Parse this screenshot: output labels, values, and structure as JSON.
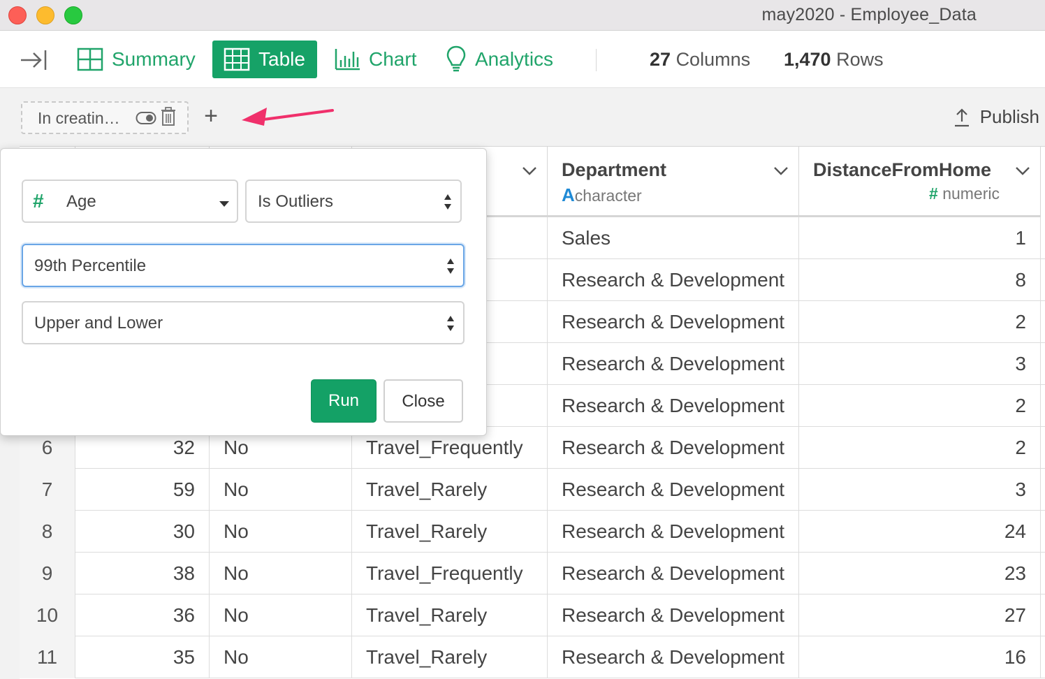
{
  "window": {
    "title": "may2020 - Employee_Data"
  },
  "toolbar": {
    "tabs": [
      {
        "label": "Summary",
        "icon": "summary-grid-icon"
      },
      {
        "label": "Table",
        "icon": "table-icon",
        "active": true
      },
      {
        "label": "Chart",
        "icon": "bar-chart-icon"
      },
      {
        "label": "Analytics",
        "icon": "lightbulb-icon"
      }
    ],
    "columns_count": "27",
    "columns_label": "Columns",
    "rows_count": "1,470",
    "rows_label": "Rows"
  },
  "steps": {
    "current_step_label": "In creatin…",
    "add_label": "+",
    "publish_label": "Publish"
  },
  "popup": {
    "column_type_symbol": "#",
    "column_value": "Age",
    "condition_value": "Is Outliers",
    "method_value": "99th Percentile",
    "side_value": "Upper and Lower",
    "run_label": "Run",
    "close_label": "Close"
  },
  "table": {
    "columns": [
      {
        "name": "",
        "type_symbol": "",
        "type": ""
      },
      {
        "name": "",
        "type_symbol": "",
        "type": ""
      },
      {
        "name": "",
        "type_symbol": "",
        "type": ""
      },
      {
        "name": "vel",
        "type_symbol": "",
        "type": ""
      },
      {
        "name": "Department",
        "type_symbol": "A",
        "type": "character"
      },
      {
        "name": "DistanceFromHome",
        "type_symbol": "#",
        "type": "numeric"
      }
    ],
    "rows": [
      {
        "idx": "",
        "age": "",
        "attrition": "",
        "travel": "",
        "department": "Sales",
        "distance": "1"
      },
      {
        "idx": "",
        "age": "",
        "attrition": "",
        "travel": "ntly",
        "department": "Research & Development",
        "distance": "8"
      },
      {
        "idx": "",
        "age": "",
        "attrition": "",
        "travel": "",
        "department": "Research & Development",
        "distance": "2"
      },
      {
        "idx": "",
        "age": "",
        "attrition": "",
        "travel": "ntly",
        "department": "Research & Development",
        "distance": "3"
      },
      {
        "idx": "",
        "age": "",
        "attrition": "",
        "travel": "",
        "department": "Research & Development",
        "distance": "2"
      },
      {
        "idx": "6",
        "age": "32",
        "attrition": "No",
        "travel": "Travel_Frequently",
        "department": "Research & Development",
        "distance": "2"
      },
      {
        "idx": "7",
        "age": "59",
        "attrition": "No",
        "travel": "Travel_Rarely",
        "department": "Research & Development",
        "distance": "3"
      },
      {
        "idx": "8",
        "age": "30",
        "attrition": "No",
        "travel": "Travel_Rarely",
        "department": "Research & Development",
        "distance": "24"
      },
      {
        "idx": "9",
        "age": "38",
        "attrition": "No",
        "travel": "Travel_Frequently",
        "department": "Research & Development",
        "distance": "23"
      },
      {
        "idx": "10",
        "age": "36",
        "attrition": "No",
        "travel": "Travel_Rarely",
        "department": "Research & Development",
        "distance": "27"
      },
      {
        "idx": "11",
        "age": "35",
        "attrition": "No",
        "travel": "Travel_Rarely",
        "department": "Research & Development",
        "distance": "16"
      }
    ]
  },
  "colors": {
    "accent_green": "#16a267",
    "character_blue": "#1f8ad6",
    "annotation_arrow": "#f0306b"
  }
}
